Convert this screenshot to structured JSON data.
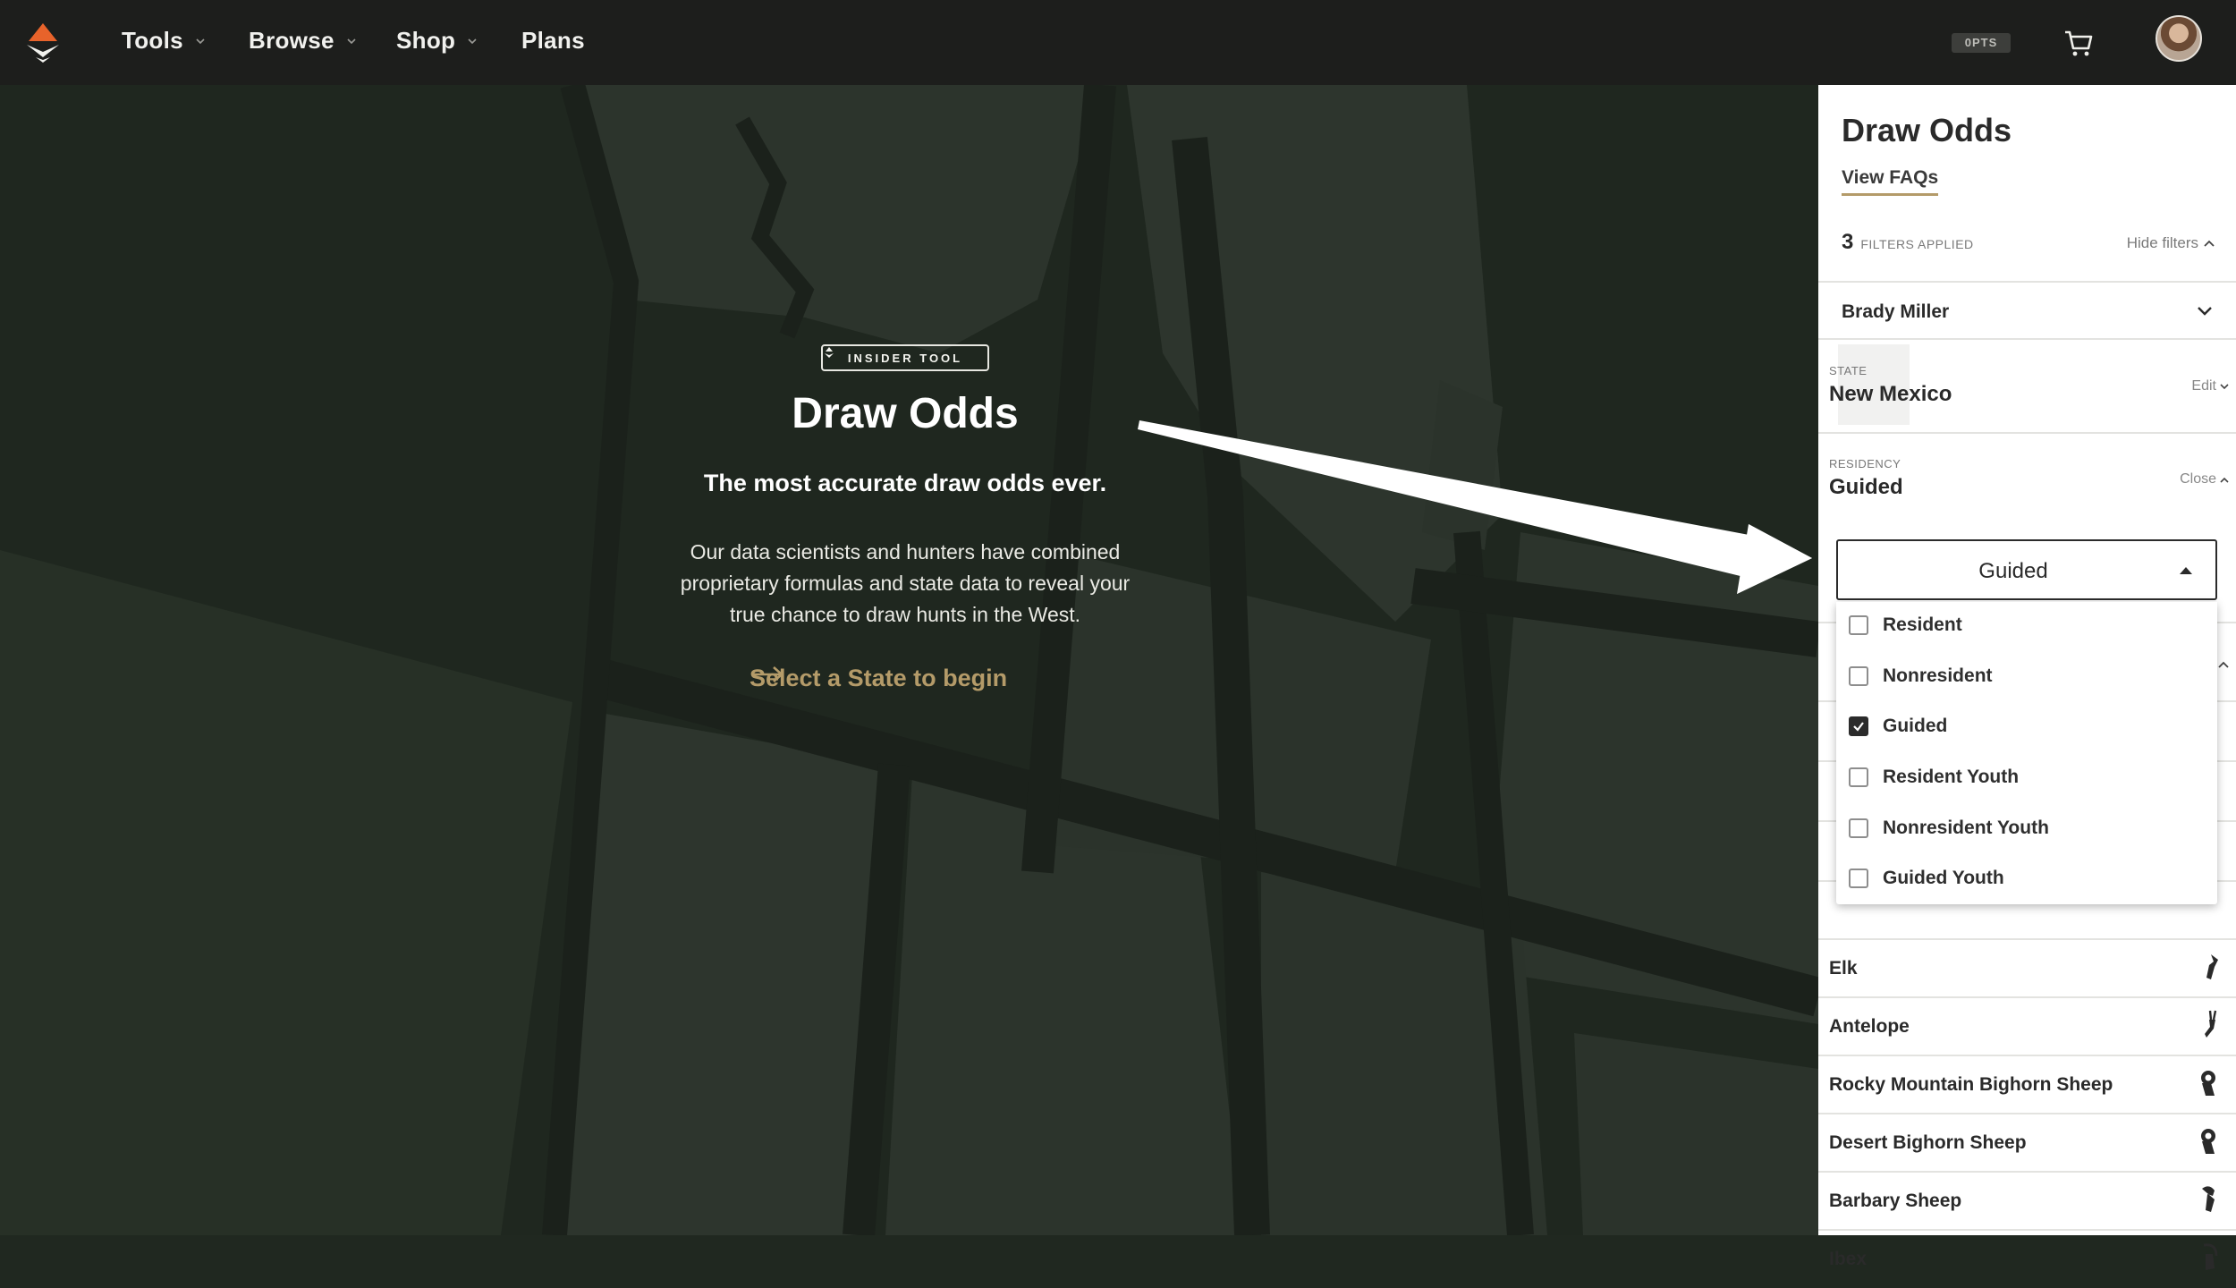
{
  "nav": {
    "items": [
      {
        "label": "Tools",
        "has_menu": true
      },
      {
        "label": "Browse",
        "has_menu": true
      },
      {
        "label": "Shop",
        "has_menu": true
      },
      {
        "label": "Plans",
        "has_menu": false
      }
    ],
    "points_badge": "0PTS",
    "cart_icon": "cart-icon",
    "avatar_icon": "avatar"
  },
  "hero": {
    "badge": "INSIDER TOOL",
    "title": "Draw Odds",
    "subtitle": "The most accurate draw odds ever.",
    "description": "Our data scientists and hunters have combined proprietary formulas and state data to reveal your true chance to draw hunts in the West.",
    "cta": "Select a State to begin"
  },
  "panel": {
    "title": "Draw Odds",
    "faq_link": "View FAQs",
    "filters_count": "3",
    "filters_label": "FILTERS APPLIED",
    "hide_filters": "Hide filters",
    "account": "Brady Miller",
    "state": {
      "label": "STATE",
      "value": "New Mexico",
      "action": "Edit"
    },
    "residency": {
      "label": "RESIDENCY",
      "value": "Guided",
      "action": "Close"
    },
    "select_value": "Guided",
    "options": [
      {
        "label": "Resident",
        "checked": false
      },
      {
        "label": "Nonresident",
        "checked": false
      },
      {
        "label": "Guided",
        "checked": true
      },
      {
        "label": "Resident Youth",
        "checked": false
      },
      {
        "label": "Nonresident Youth",
        "checked": false
      },
      {
        "label": "Guided Youth",
        "checked": false
      }
    ],
    "species": [
      {
        "name": "Elk",
        "icon": "elk-icon"
      },
      {
        "name": "Antelope",
        "icon": "antelope-icon"
      },
      {
        "name": "Rocky Mountain Bighorn Sheep",
        "icon": "bighorn-sheep-icon"
      },
      {
        "name": "Desert Bighorn Sheep",
        "icon": "desert-sheep-icon"
      },
      {
        "name": "Barbary Sheep",
        "icon": "barbary-sheep-icon"
      },
      {
        "name": "Ibex",
        "icon": "ibex-icon"
      }
    ]
  },
  "colors": {
    "nav_bg": "#1d1e1c",
    "map_bg": "#202820",
    "accent_gold": "#b49b69",
    "panel_bg": "#ffffff",
    "brand_orange": "#e8632b"
  }
}
